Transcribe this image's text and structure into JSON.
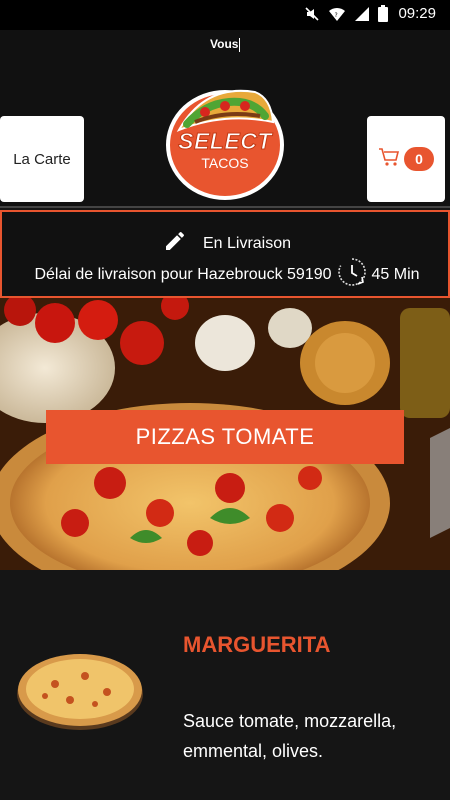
{
  "status_bar": {
    "time": "09:29",
    "icons": [
      "mute-icon",
      "wifi-icon",
      "signal-icon",
      "battery-icon"
    ]
  },
  "header": {
    "user_label": "Vous",
    "menu_label": "La Carte",
    "cart_count": "0",
    "logo": {
      "line1": "SELECT",
      "line2": "TACOS"
    }
  },
  "delivery": {
    "mode": "En Livraison",
    "info": "Délai de livraison pour Hazebrouck 59190",
    "time": "45 Min"
  },
  "category": {
    "label": "PIZZAS TOMATE"
  },
  "product": {
    "name": "MARGUERITA",
    "description": "Sauce tomate, mozzarella, emmental, olives."
  },
  "colors": {
    "accent": "#e8552f",
    "background": "#151515"
  }
}
